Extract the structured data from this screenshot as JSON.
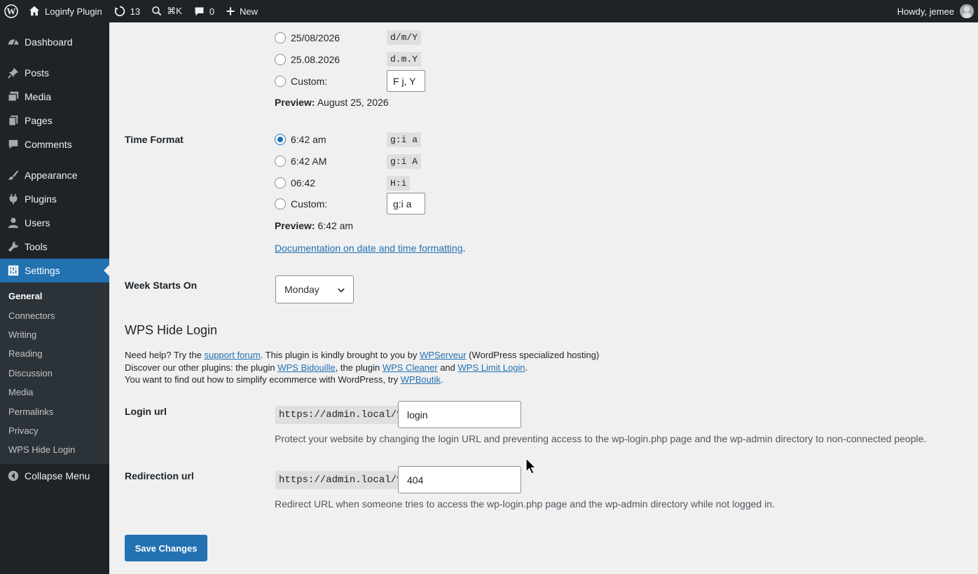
{
  "adminbar": {
    "site_name": "Loginfy Plugin",
    "updates_count": "13",
    "search_shortcut": "⌘K",
    "comments_count": "0",
    "new_label": "New",
    "greeting": "Howdy, jemee"
  },
  "sidebar": {
    "items": [
      {
        "label": "Dashboard",
        "icon": "dashboard-icon"
      },
      {
        "label": "Posts",
        "icon": "pin-icon"
      },
      {
        "label": "Media",
        "icon": "media-icon"
      },
      {
        "label": "Pages",
        "icon": "pages-icon"
      },
      {
        "label": "Comments",
        "icon": "comment-icon"
      },
      {
        "label": "Appearance",
        "icon": "paintbrush-icon"
      },
      {
        "label": "Plugins",
        "icon": "plugin-icon"
      },
      {
        "label": "Users",
        "icon": "user-icon"
      },
      {
        "label": "Tools",
        "icon": "wrench-icon"
      },
      {
        "label": "Settings",
        "icon": "settings-icon"
      }
    ],
    "submenu": [
      "General",
      "Connectors",
      "Writing",
      "Reading",
      "Discussion",
      "Media",
      "Permalinks",
      "Privacy",
      "WPS Hide Login"
    ],
    "collapse_label": "Collapse Menu"
  },
  "date_format": {
    "options": [
      {
        "label": "25/08/2026",
        "format": "d/m/Y"
      },
      {
        "label": "25.08.2026",
        "format": "d.m.Y"
      },
      {
        "label": "Custom:",
        "format": "F j, Y"
      }
    ],
    "preview_label": "Preview:",
    "preview_value": "August 25, 2026"
  },
  "time_format": {
    "label": "Time Format",
    "options": [
      {
        "label": "6:42 am",
        "format": "g:i a",
        "checked": true
      },
      {
        "label": "6:42 AM",
        "format": "g:i A"
      },
      {
        "label": "06:42",
        "format": "H:i"
      },
      {
        "label": "Custom:",
        "format": "g:i a"
      }
    ],
    "preview_label": "Preview:",
    "preview_value": "6:42 am",
    "doc_link": "Documentation on date and time formatting",
    "doc_suffix": "."
  },
  "week_starts": {
    "label": "Week Starts On",
    "value": "Monday"
  },
  "wps": {
    "heading": "WPS Hide Login",
    "help": {
      "t1": "Need help? Try the ",
      "link1": "support forum",
      "t2": ". This plugin is kindly brought to you by ",
      "link2": "WPServeur",
      "t3": " (WordPress specialized hosting)",
      "t4": "Discover our other plugins: the plugin ",
      "link3": "WPS Bidouille",
      "t5": ", the plugin ",
      "link4": "WPS Cleaner",
      "t6": " and ",
      "link5": "WPS Limit Login",
      "t7": ".",
      "t8": "You want to find out how to simplify ecommerce with WordPress, try ",
      "link6": "WPBoutik",
      "t9": "."
    },
    "login_url": {
      "label": "Login url",
      "prefix": "https://admin.local/?",
      "value": "login",
      "description": "Protect your website by changing the login URL and preventing access to the wp-login.php page and the wp-admin directory to non-connected people."
    },
    "redirection_url": {
      "label": "Redirection url",
      "prefix": "https://admin.local/?",
      "value": "404",
      "description": "Redirect URL when someone tries to access the wp-login.php page and the wp-admin directory while not logged in."
    }
  },
  "save_label": "Save Changes",
  "colors": {
    "accent": "#2271b1",
    "adminbar_bg": "#1d2327",
    "page_bg": "#f0f0f1"
  }
}
